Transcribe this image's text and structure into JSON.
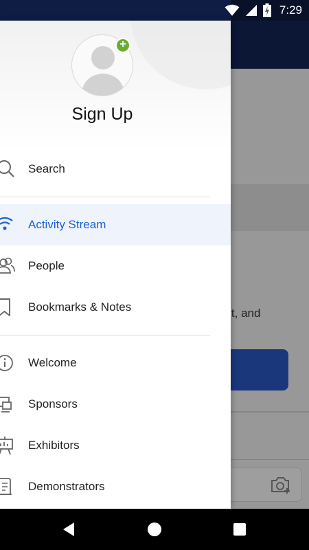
{
  "status_bar": {
    "time": "7:29"
  },
  "drawer": {
    "profile": {
      "title": "Sign Up"
    },
    "sections": [
      {
        "items": [
          {
            "label": "Search",
            "icon": "search-icon"
          }
        ]
      },
      {
        "items": [
          {
            "label": "Activity Stream",
            "icon": "activity-stream-icon",
            "active": true
          },
          {
            "label": "People",
            "icon": "people-icon"
          },
          {
            "label": "Bookmarks & Notes",
            "icon": "bookmark-icon"
          }
        ]
      },
      {
        "items": [
          {
            "label": "Welcome",
            "icon": "info-icon"
          },
          {
            "label": "Sponsors",
            "icon": "sponsors-icon"
          },
          {
            "label": "Exhibitors",
            "icon": "exhibitors-icon"
          },
          {
            "label": "Demonstrators",
            "icon": "demonstrators-icon"
          }
        ]
      }
    ]
  },
  "background_app": {
    "partial_text": "ent, and"
  },
  "colors": {
    "header": "#142456",
    "accent": "#1f61d0",
    "active_bg": "#eef3fc",
    "add_badge": "#6cad2f"
  }
}
